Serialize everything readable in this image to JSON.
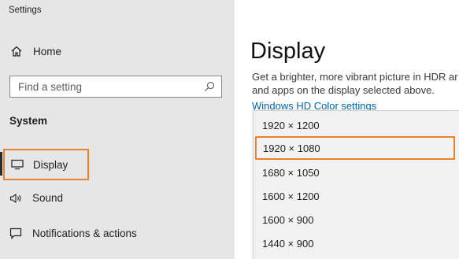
{
  "window": {
    "title": "Settings"
  },
  "sidebar": {
    "home": {
      "label": "Home",
      "icon": "home-icon"
    },
    "search": {
      "placeholder": "Find a setting",
      "icon": "search-icon"
    },
    "section_heading": "System",
    "items": [
      {
        "label": "Display",
        "icon": "monitor-icon",
        "active": true
      },
      {
        "label": "Sound",
        "icon": "speaker-icon"
      },
      {
        "label": "Notifications & actions",
        "icon": "notifications-icon"
      }
    ]
  },
  "main": {
    "title": "Display",
    "description": "Get a brighter, more vibrant picture in HDR ar and apps on the display selected above.",
    "link": "Windows HD Color settings"
  },
  "resolution_dropdown": {
    "selected": "1920 × 1080",
    "options": [
      "1920 × 1200",
      "1920 × 1080",
      "1680 × 1050",
      "1600 × 1200",
      "1600 × 900",
      "1440 × 900"
    ]
  },
  "colors": {
    "highlight": "#e8822c",
    "link": "#0063b1",
    "sidebar_bg": "#e6e6e6",
    "dropdown_bg": "#f2f2f2"
  }
}
